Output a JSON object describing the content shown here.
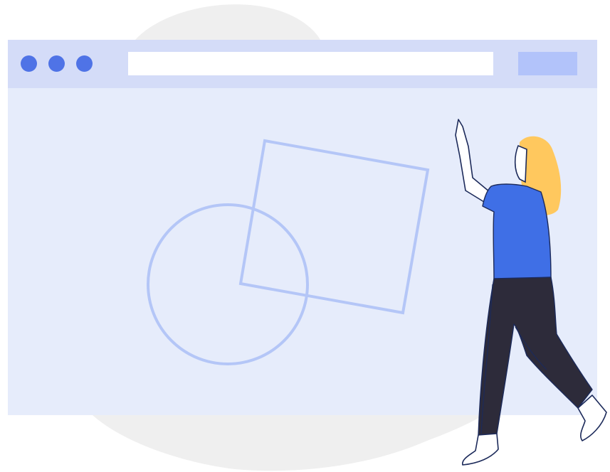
{
  "colors": {
    "page_bg": "#ffffff",
    "blob": "#efefef",
    "window_bg": "#e6ecfb",
    "titlebar_bg": "#d4dcf8",
    "window_dot": "#4f73e6",
    "address_bar": "#ffffff",
    "toolbar_button": "#b2c3fa",
    "shape_stroke": "#b4c6f7",
    "hair": "#ffc85e",
    "shirt": "#3f6fe6",
    "pants": "#2d2b3a",
    "outline": "#1c2a5a",
    "skin": "#ffffff"
  },
  "window": {
    "dots": [
      "circle-dot",
      "circle-dot",
      "circle-dot"
    ]
  },
  "illustration": {
    "shapes": [
      "circle",
      "square"
    ],
    "figure": "woman-touching-screen"
  }
}
